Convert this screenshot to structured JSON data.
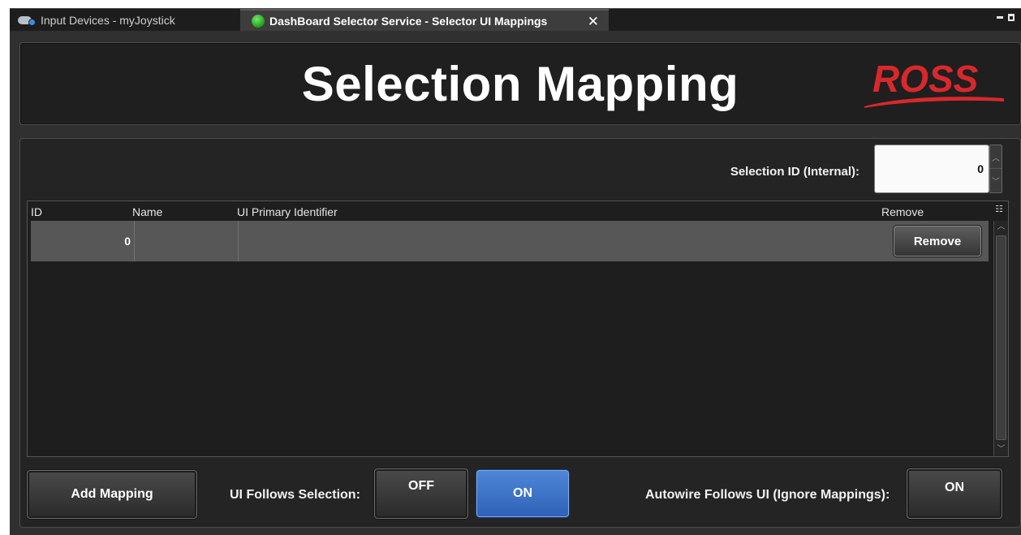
{
  "tabs": [
    {
      "label": "Input Devices - myJoystick",
      "icon": "gamepad-icon"
    },
    {
      "label": "DashBoard Selector Service - Selector UI Mappings",
      "icon": "status-dot"
    }
  ],
  "header": {
    "title": "Selection Mapping",
    "logo_text": "ROSS"
  },
  "selection_id": {
    "label": "Selection ID (Internal):",
    "value": "0"
  },
  "table": {
    "columns": [
      "ID",
      "Name",
      "UI Primary Identifier",
      "Remove"
    ],
    "rows": [
      {
        "id": "0",
        "name": "",
        "ui_primary_identifier": "",
        "remove_label": "Remove"
      }
    ]
  },
  "controls": {
    "add_mapping_label": "Add Mapping",
    "ui_follows_label": "UI Follows Selection:",
    "off_label": "OFF",
    "on_label": "ON",
    "autowire_label": "Autowire Follows UI (Ignore Mappings):",
    "autowire_on_label": "ON"
  },
  "colors": {
    "accent_blue": "#3f74c8",
    "logo_red": "#d8282c",
    "status_green": "#2fbf26"
  }
}
